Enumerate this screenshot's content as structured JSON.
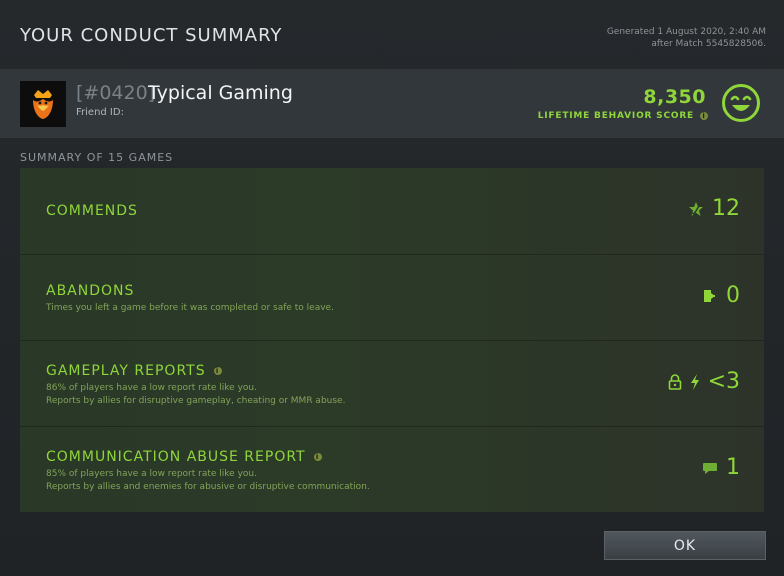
{
  "dialog": {
    "title": "YOUR CONDUCT SUMMARY",
    "generated_line1": "Generated 1 August 2020, 2:40 AM",
    "generated_line2": "after Match 5545828506."
  },
  "player": {
    "tag": "[#0420]",
    "name": "Typical Gaming",
    "friend_id_label": "Friend ID:",
    "avatar_icon": "lion-crown-icon"
  },
  "score": {
    "value": "8,350",
    "label": "LIFETIME BEHAVIOR SCORE",
    "face_icon": "smiley-face-icon"
  },
  "summary": {
    "label": "SUMMARY OF 15 GAMES",
    "rows": [
      {
        "title": "COMMENDS",
        "desc1": "",
        "desc2": "",
        "value": "12",
        "icon": "star-commend-icon"
      },
      {
        "title": "ABANDONS",
        "desc1": "Times you left a game before it was completed or safe to leave.",
        "desc2": "",
        "value": "0",
        "icon": "exit-door-icon"
      },
      {
        "title": "GAMEPLAY REPORTS",
        "desc1": "86% of players have a low report rate like you.",
        "desc2": "Reports by allies for disruptive gameplay, cheating or MMR abuse.",
        "value": "<3",
        "icon": "lock-lightning-icon"
      },
      {
        "title": "COMMUNICATION ABUSE REPORT",
        "desc1": "85% of players have a low report rate like you.",
        "desc2": "Reports by allies and enemies for abusive or disruptive communication.",
        "value": "1",
        "icon": "chat-bubble-icon"
      }
    ]
  },
  "buttons": {
    "ok": "OK"
  },
  "colors": {
    "accent_green": "#8fd63a"
  }
}
